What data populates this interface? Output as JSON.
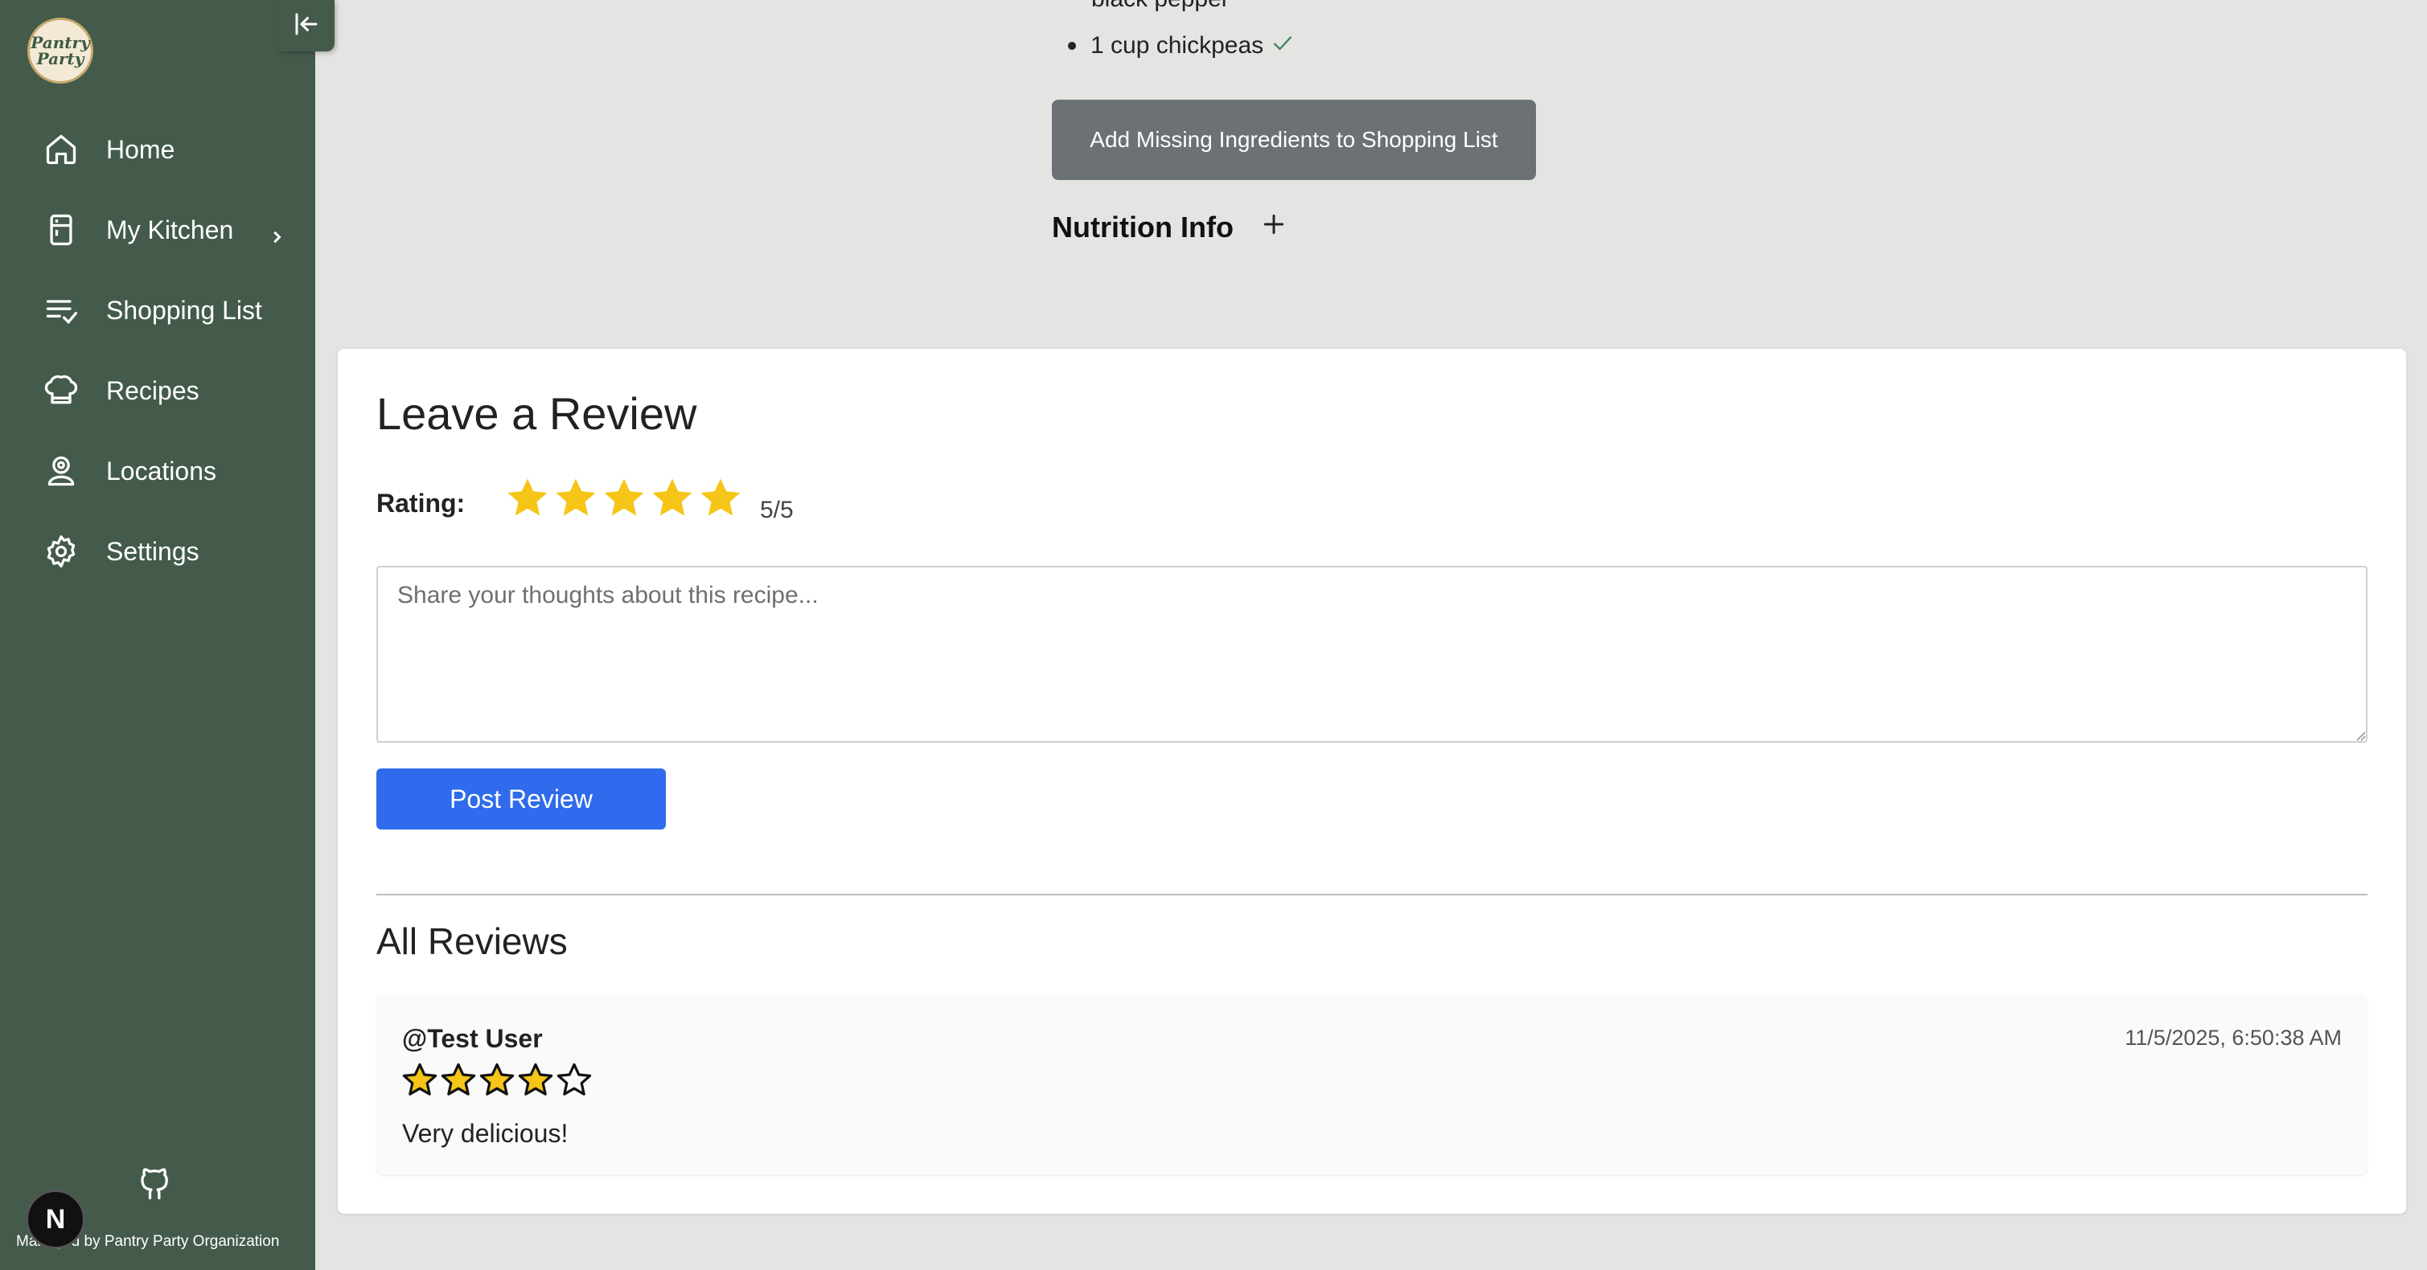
{
  "sidebar": {
    "logo_line1": "Pantry",
    "logo_line2": "Party",
    "items": [
      {
        "label": "Home",
        "icon": "home-icon"
      },
      {
        "label": "My Kitchen",
        "icon": "fridge-icon",
        "has_submenu": true
      },
      {
        "label": "Shopping List",
        "icon": "list-check-icon"
      },
      {
        "label": "Recipes",
        "icon": "chef-hat-icon"
      },
      {
        "label": "Locations",
        "icon": "map-pin-icon"
      },
      {
        "label": "Settings",
        "icon": "gear-icon"
      }
    ],
    "footer_text": "Managed by Pantry Party Organization",
    "next_badge": "N",
    "colors": {
      "background": "#445b4c",
      "text": "#ffffff"
    }
  },
  "recipe": {
    "partial_ingredient": "black pepper",
    "ingredient": "1 cup chickpeas",
    "ingredient_status": "check-icon",
    "add_missing_label": "Add Missing Ingredients to Shopping List",
    "nutrition_label": "Nutrition Info"
  },
  "review_form": {
    "title": "Leave a Review",
    "rating_label": "Rating:",
    "rating": 5,
    "rating_max": 5,
    "rating_text": "5/5",
    "textarea_placeholder": "Share your thoughts about this recipe...",
    "textarea_value": "",
    "post_label": "Post Review",
    "colors": {
      "star": "#f5c518",
      "post_button": "#2f6bec"
    }
  },
  "reviews": {
    "title": "All Reviews",
    "items": [
      {
        "user": "@Test User",
        "date": "11/5/2025, 6:50:38 AM",
        "rating": 4,
        "rating_max": 5,
        "text": "Very delicious!"
      }
    ]
  }
}
